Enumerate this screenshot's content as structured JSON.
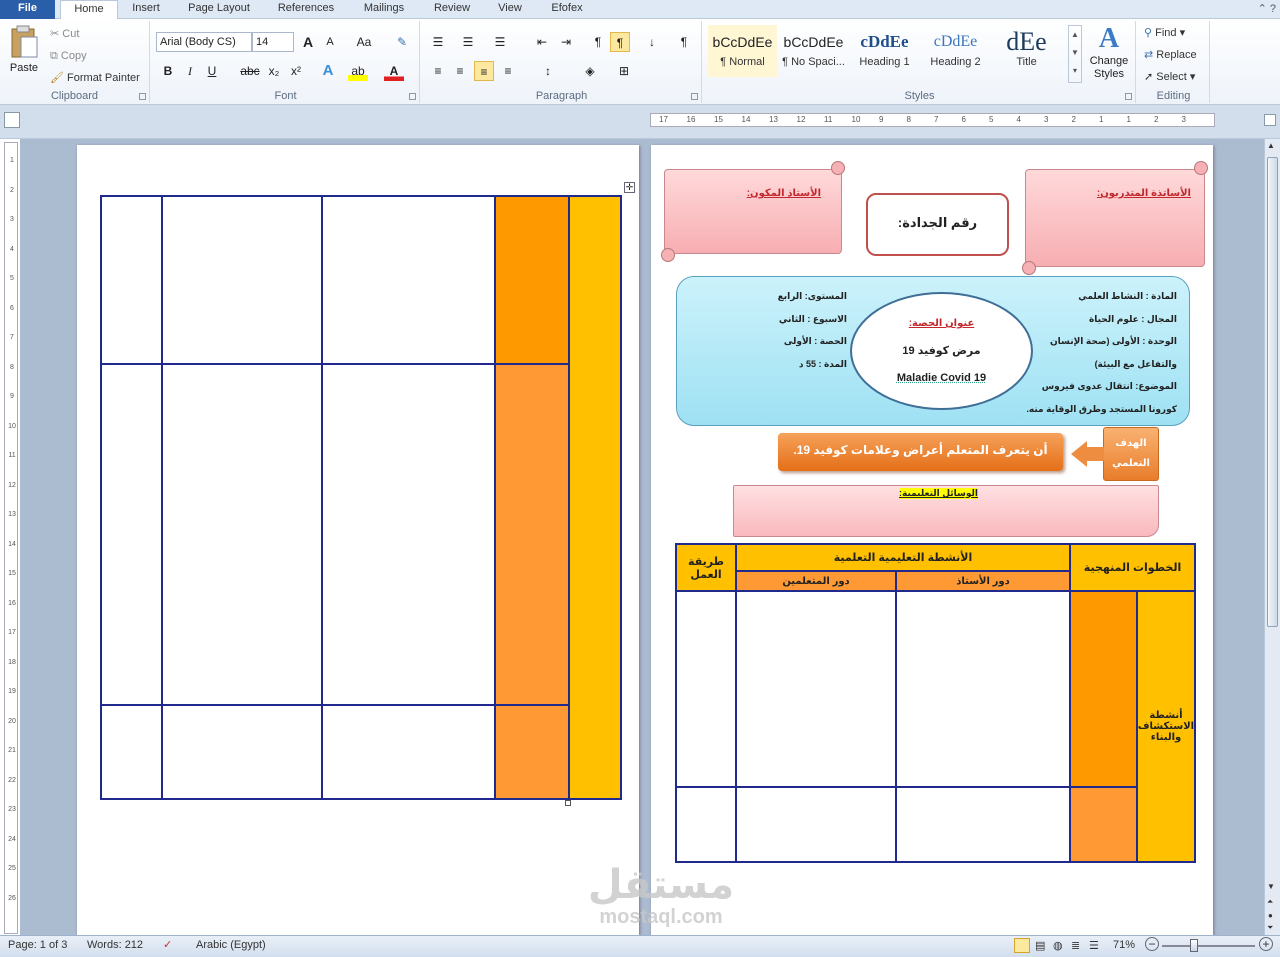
{
  "tabs": [
    "File",
    "Home",
    "Insert",
    "Page Layout",
    "References",
    "Mailings",
    "Review",
    "View",
    "Efofex"
  ],
  "clipboard": {
    "paste": "Paste",
    "cut": "Cut",
    "copy": "Copy",
    "format_painter": "Format Painter",
    "label": "Clipboard"
  },
  "font": {
    "name": "Arial (Body CS)",
    "size": "14",
    "label": "Font",
    "bold": "B",
    "italic": "I",
    "underline": "U",
    "strike": "abc",
    "sub": "x₂",
    "sup": "x²",
    "grow": "A",
    "shrink": "A",
    "case": "Aa"
  },
  "paragraph": {
    "label": "Paragraph",
    "pilcrow": "¶"
  },
  "styles": {
    "label": "Styles",
    "items": [
      {
        "preview": "bCcDdEe",
        "name": "¶ Normal"
      },
      {
        "preview": "bCcDdEe",
        "name": "¶ No Spaci..."
      },
      {
        "preview": "cDdEe",
        "name": "Heading 1"
      },
      {
        "preview": "cDdEe",
        "name": "Heading 2"
      },
      {
        "preview": "dEe",
        "name": "Title"
      }
    ],
    "change": "Change Styles"
  },
  "editing": {
    "label": "Editing",
    "find": "Find",
    "replace": "Replace",
    "select": "Select"
  },
  "ruler": {
    "numbers": [
      "17",
      "16",
      "15",
      "14",
      "13",
      "12",
      "11",
      "10",
      "9",
      "8",
      "7",
      "6",
      "5",
      "4",
      "3",
      "2",
      "1",
      "1",
      "2",
      "3"
    ],
    "vnumbers": [
      "1",
      "2",
      "3",
      "4",
      "5",
      "6",
      "7",
      "8",
      "9",
      "10",
      "11",
      "12",
      "13",
      "14",
      "15",
      "16",
      "17",
      "18",
      "19",
      "20",
      "21",
      "22",
      "23",
      "24",
      "25",
      "26"
    ]
  },
  "doc": {
    "trainer_label": "الأستاذ المكون:",
    "trainees_label": "الأساتذة المتدربون:",
    "grade_number": "رقم الجدادة:",
    "lesson_title_label": "عنوان الحصة:",
    "lesson_title_ar": "مرض كوفيد 19",
    "lesson_title_fr": "Maladie  Covid  19",
    "right_info": [
      "المادة      :   النشاط العلمي",
      "المجال     :  علوم الحياة",
      "الوحدة     :  الأولى (صحة الإنسان",
      "والتفاعل مع البيئة)",
      "الموضوع: انتقال عدوى فيروس",
      "كورونا المستجد وطرق الوقاية منه."
    ],
    "left_info": [
      "المستوى: الرابع",
      "الاسبوع  :  الثاني",
      "الحصة    :  الأولى",
      "المدة      :  55 د"
    ],
    "objective_label": "الهدف التعلمي",
    "objective_text": "أن يتعرف المتعلم أعراض وعلامات كوفيد 19.",
    "means_label": "الوسائل التعليمية:",
    "table": {
      "col_method": "طريقة العمل",
      "col_activities": "الأنشطة التعليمية التعلمية",
      "col_steps": "الخطوات المنهجية",
      "sub_teacher": "دور الأستاذ",
      "sub_learners": "دور المتعلمين",
      "phase": "أنشطة الاستكشاف والبناء"
    }
  },
  "status": {
    "page": "Page: 1 of 3",
    "words": "Words: 212",
    "lang": "Arabic (Egypt)",
    "zoom": "71%"
  },
  "watermark": {
    "ar": "مستقل",
    "en": "mostaql.com"
  }
}
